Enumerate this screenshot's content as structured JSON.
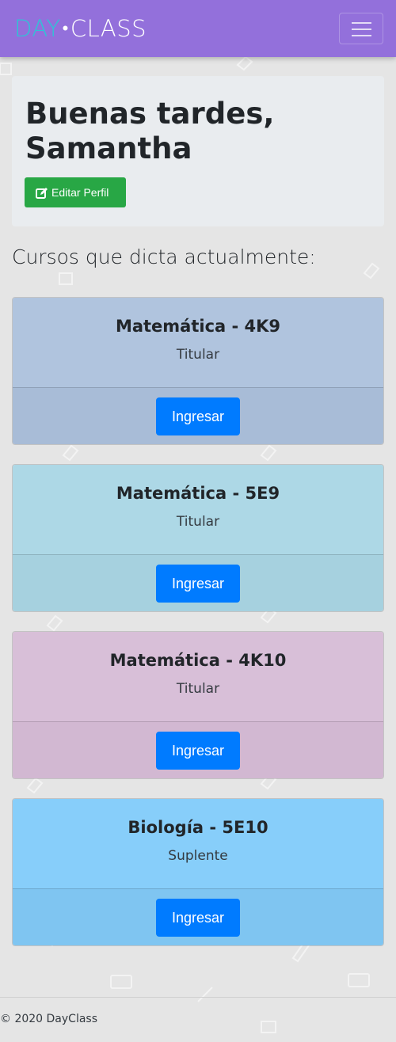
{
  "navbar": {
    "brand_part1": "DAY",
    "brand_dot": "•",
    "brand_part2": "CLASS",
    "menu_icon": "hamburger-icon"
  },
  "header": {
    "greeting": "Buenas tardes, Samantha",
    "edit_profile_label": "Editar Perfil",
    "edit_icon": "edit-icon"
  },
  "courses_title": "Cursos que dicta actualmente:",
  "courses": [
    {
      "name": "Matemática - 4K9",
      "role": "Titular",
      "button": "Ingresar",
      "color_body": "#b0c4de",
      "color_footer": "#a8bcd7"
    },
    {
      "name": "Matemática - 5E9",
      "role": "Titular",
      "button": "Ingresar",
      "color_body": "#add8e6",
      "color_footer": "#a6d1df"
    },
    {
      "name": "Matemática - 4K10",
      "role": "Titular",
      "button": "Ingresar",
      "color_body": "#d8bfd8",
      "color_footer": "#d2b8d2"
    },
    {
      "name": "Biología - 5E10",
      "role": "Suplente",
      "button": "Ingresar",
      "color_body": "#87cefa",
      "color_footer": "#7fc5f1"
    }
  ],
  "footer": {
    "copyright": "© 2020 DayClass"
  },
  "colors": {
    "navbar": "#9370db",
    "brand_accent": "#2ec4d6",
    "edit_button": "#28a745",
    "primary_button": "#007bff"
  }
}
